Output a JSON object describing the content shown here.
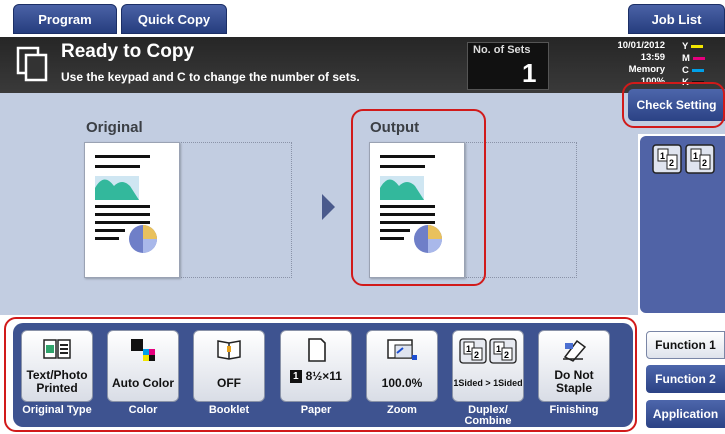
{
  "tabs": {
    "program": "Program",
    "quick_copy": "Quick Copy",
    "job_list": "Job List"
  },
  "header": {
    "title": "Ready to Copy",
    "subtitle": "Use the keypad and C to change the number of sets.",
    "sets_label": "No. of Sets",
    "sets_value": "1",
    "date": "10/01/2012",
    "time": "13:59",
    "memory": "Memory",
    "memory_value": "100%",
    "toner": [
      {
        "letter": "Y",
        "color": "#f2e600"
      },
      {
        "letter": "M",
        "color": "#e5007e"
      },
      {
        "letter": "C",
        "color": "#00a0e9"
      },
      {
        "letter": "K",
        "color": "#111111"
      }
    ]
  },
  "check_setting": "Check Setting",
  "preview": {
    "original_label": "Original",
    "output_label": "Output"
  },
  "functions": [
    {
      "value": "Text/Photo\nPrinted",
      "caption": "Original Type",
      "icon": "original-type-icon"
    },
    {
      "value": "Auto Color",
      "caption": "Color",
      "icon": "color-icon"
    },
    {
      "value": "OFF",
      "caption": "Booklet",
      "icon": "booklet-icon"
    },
    {
      "value": "8½×11",
      "caption": "Paper",
      "tray": "1",
      "icon": "paper-icon"
    },
    {
      "value": "100.0%",
      "caption": "Zoom",
      "icon": "zoom-icon"
    },
    {
      "value": "1Sided > 1Sided",
      "caption": "Duplex/\nCombine",
      "icon": "duplex-icon"
    },
    {
      "value": "Do Not\nStaple",
      "caption": "Finishing",
      "icon": "staple-icon"
    }
  ],
  "side_menu": {
    "function1": "Function 1",
    "function2": "Function 2",
    "application": "Application"
  },
  "colors": {
    "accent": "#2b4285",
    "highlight": "#d11a1a",
    "work_area": "#c2cde1"
  }
}
